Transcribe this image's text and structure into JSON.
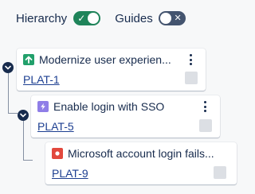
{
  "toggles": {
    "hierarchy": {
      "label": "Hierarchy",
      "state": "on",
      "glyph": "✓"
    },
    "guides": {
      "label": "Guides",
      "state": "off",
      "glyph": "✕"
    }
  },
  "issues": [
    {
      "summary": "Modernize user experien...",
      "key": "PLAT-1",
      "type": "story",
      "type_icon": "arrow-up-icon",
      "type_color": "#22a06b"
    },
    {
      "summary": "Enable login with SSO",
      "key": "PLAT-5",
      "type": "task",
      "type_icon": "lightning-icon",
      "type_color": "#8f7ee7"
    },
    {
      "summary": "Microsoft account login fails...",
      "key": "PLAT-9",
      "type": "bug",
      "type_icon": "bug-icon",
      "type_color": "#e2483d"
    }
  ],
  "colors": {
    "accent_on": "#1f845a",
    "toggle_off": "#44546f",
    "text": "#172b4d"
  }
}
